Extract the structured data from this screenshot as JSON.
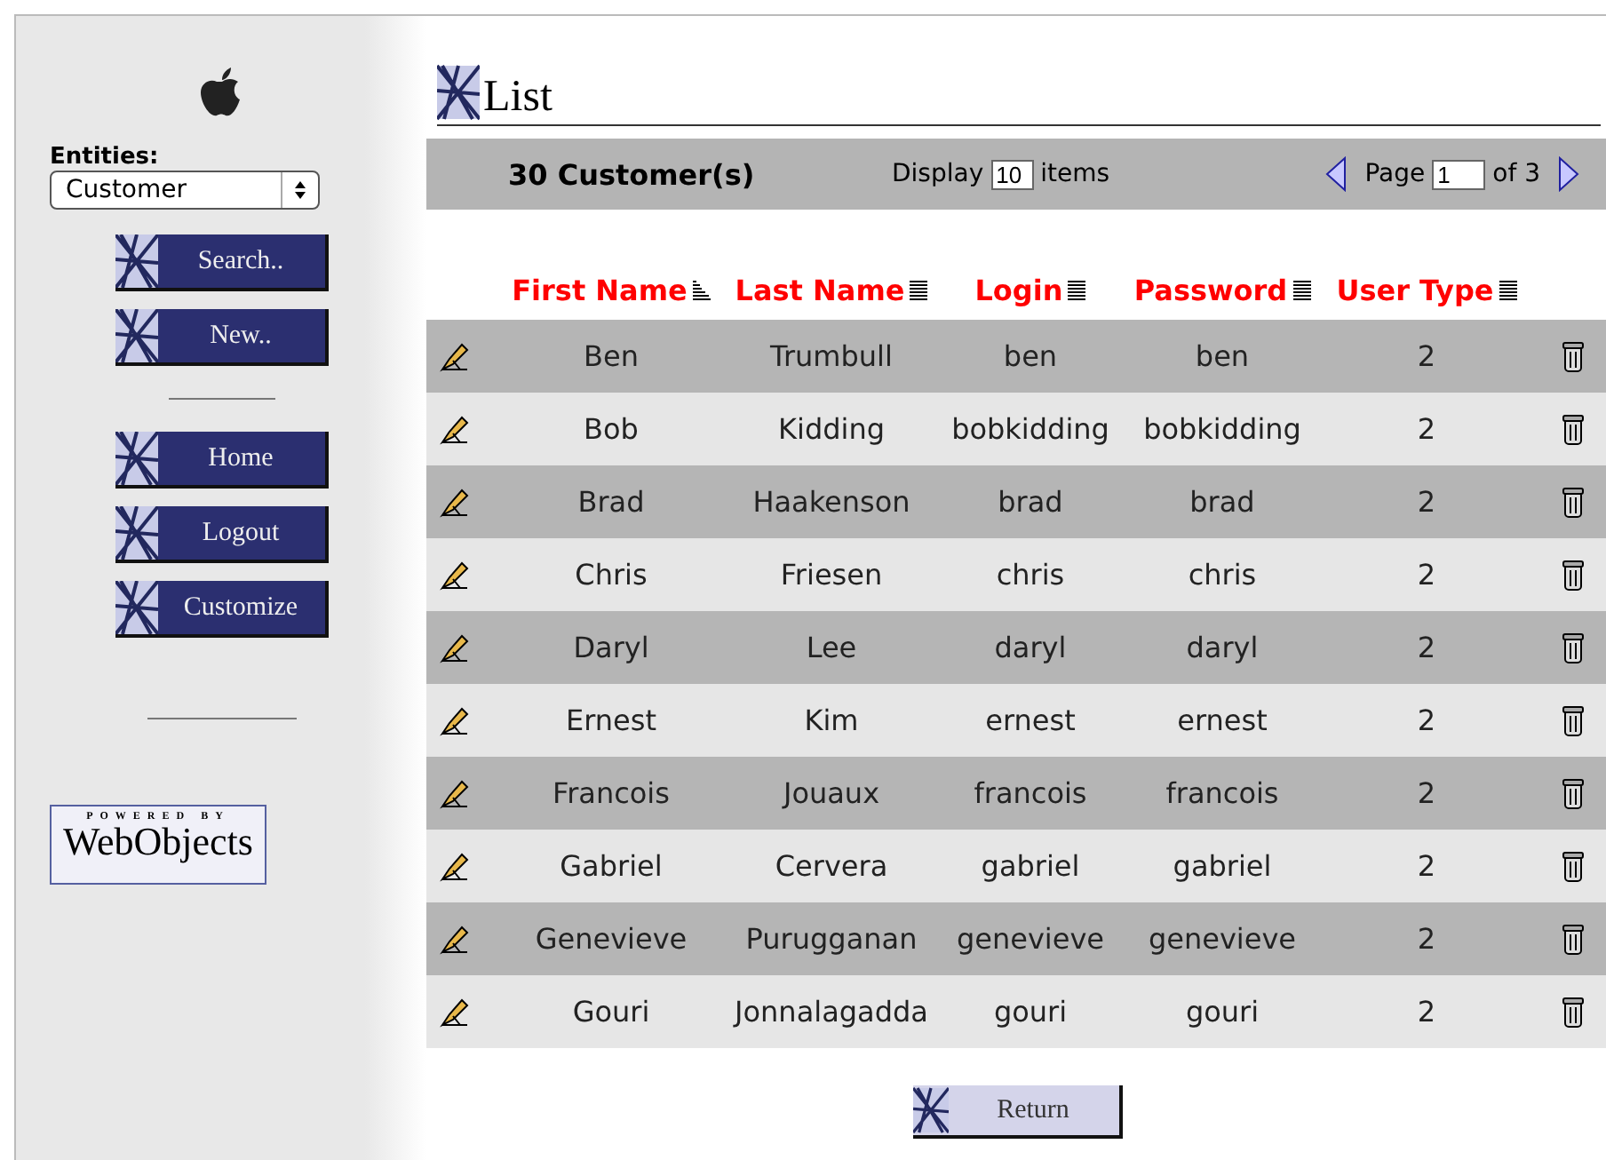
{
  "sidebar": {
    "entities_label": "Entities:",
    "entity_select": "Customer",
    "buttons_top": [
      "Search..",
      "New.."
    ],
    "buttons_bottom": [
      "Home",
      "Logout",
      "Customize"
    ],
    "badge": {
      "top": "POWERED BY",
      "bottom": "WebObjects"
    }
  },
  "page_title": "List",
  "toolbar": {
    "count": "30 Customer(s)",
    "display_label": "Display",
    "display_value": "10",
    "items_label": "items",
    "page_label": "Page",
    "page_value": "1",
    "page_of": "of 3"
  },
  "columns": [
    {
      "label": "First Name",
      "sorted": true
    },
    {
      "label": "Last Name",
      "sorted": false
    },
    {
      "label": "Login",
      "sorted": false
    },
    {
      "label": "Password",
      "sorted": false
    },
    {
      "label": "User Type",
      "sorted": false
    }
  ],
  "rows": [
    [
      "Ben",
      "Trumbull",
      "ben",
      "ben",
      "2"
    ],
    [
      "Bob",
      "Kidding",
      "bobkidding",
      "bobkidding",
      "2"
    ],
    [
      "Brad",
      "Haakenson",
      "brad",
      "brad",
      "2"
    ],
    [
      "Chris",
      "Friesen",
      "chris",
      "chris",
      "2"
    ],
    [
      "Daryl",
      "Lee",
      "daryl",
      "daryl",
      "2"
    ],
    [
      "Ernest",
      "Kim",
      "ernest",
      "ernest",
      "2"
    ],
    [
      "Francois",
      "Jouaux",
      "francois",
      "francois",
      "2"
    ],
    [
      "Gabriel",
      "Cervera",
      "gabriel",
      "gabriel",
      "2"
    ],
    [
      "Genevieve",
      "Purugganan",
      "genevieve",
      "genevieve",
      "2"
    ],
    [
      "Gouri",
      "Jonnalagadda",
      "gouri",
      "gouri",
      "2"
    ]
  ],
  "return_button": "Return"
}
